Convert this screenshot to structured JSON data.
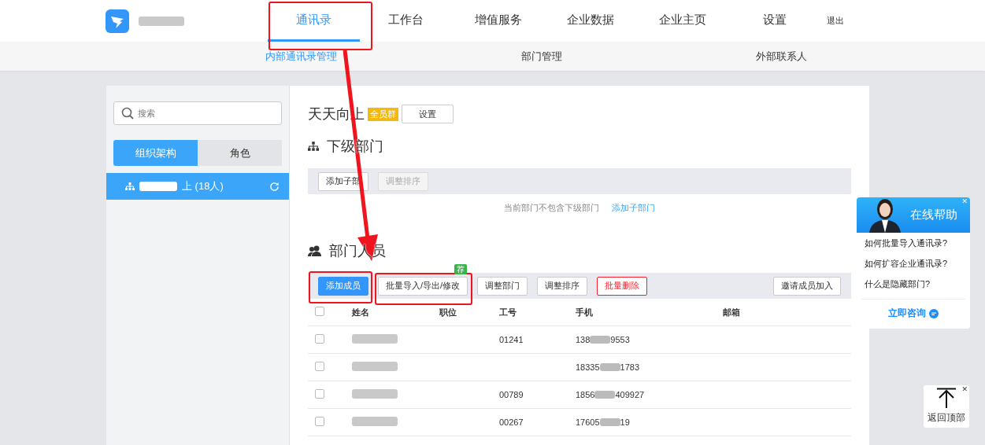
{
  "nav": {
    "items": [
      {
        "label": "通讯录",
        "selected": true
      },
      {
        "label": "工作台",
        "selected": false
      },
      {
        "label": "增值服务",
        "selected": false
      },
      {
        "label": "企业数据",
        "selected": false
      },
      {
        "label": "企业主页",
        "selected": false
      },
      {
        "label": "设置",
        "selected": false
      }
    ],
    "logout": "退出"
  },
  "subnav": [
    {
      "label": "内部通讯录管理",
      "selected": true
    },
    {
      "label": "部门管理",
      "selected": false
    },
    {
      "label": "外部联系人",
      "selected": false
    }
  ],
  "sidebar": {
    "search": {
      "placeholder": "搜索"
    },
    "tabs": [
      {
        "label": "组织架构",
        "selected": true
      },
      {
        "label": "角色",
        "selected": false
      }
    ],
    "tree": [
      {
        "label": "上 (18人)",
        "selected": true
      }
    ]
  },
  "org": {
    "title": "天天向上",
    "badge": "全员群",
    "settings": "设置"
  },
  "subdepts": {
    "heading": "下级部门",
    "buttons": [
      {
        "label": "添加子部",
        "disabled": false
      },
      {
        "label": "调整排序",
        "disabled": true
      }
    ],
    "empty": "当前部门不包含下级部门",
    "empty_link": "添加子部门"
  },
  "members": {
    "heading": "部门人员",
    "buttons": [
      {
        "label": "添加成员",
        "kind": "primary"
      },
      {
        "label": "批量导入/导出/修改",
        "kind": "plain",
        "tag": "荐"
      },
      {
        "label": "调整部门",
        "kind": "plain"
      },
      {
        "label": "调整排序",
        "kind": "plain"
      },
      {
        "label": "批量删除",
        "kind": "danger"
      }
    ],
    "invite": "邀请成员加入",
    "all_checked": false,
    "columns": [
      "姓名",
      "职位",
      "工号",
      "手机",
      "邮箱"
    ],
    "rows": [
      {
        "checked": false,
        "id": "01241",
        "phone_head": "138",
        "phone_tail": "9553"
      },
      {
        "checked": false,
        "phone_head": "18335",
        "phone_tail": "1783"
      },
      {
        "checked": false,
        "id": "00789",
        "phone_head": "1856",
        "phone_tail": "409927"
      },
      {
        "checked": false,
        "id": "00267",
        "phone_head": "17605",
        "phone_tail": "19"
      }
    ]
  },
  "help": {
    "title": "在线帮助",
    "questions": [
      "如何批量导入通讯录?",
      "如何扩容企业通讯录?",
      "什么是隐藏部门?"
    ],
    "consult": "立即咨询",
    "close": "✕"
  },
  "back_to_top": "返回顶部",
  "back_to_top_close": "✕"
}
